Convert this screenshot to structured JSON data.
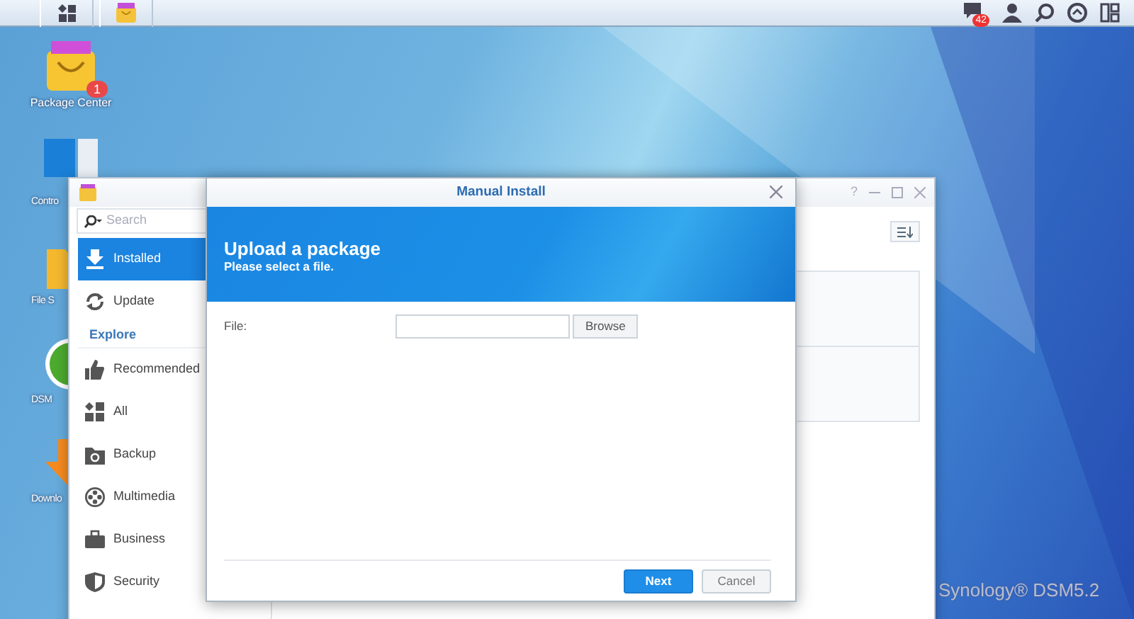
{
  "taskbar": {
    "notification_count": "42"
  },
  "desktop": {
    "icons": [
      {
        "label": "Package Center",
        "badge": "1"
      },
      {
        "label": "Contro"
      },
      {
        "label": "File S"
      },
      {
        "label": "DSM"
      },
      {
        "label": "Downlo"
      }
    ],
    "brand": "Synology® DSM5.2"
  },
  "package_center": {
    "help_label": "?",
    "search": {
      "placeholder": "Search"
    },
    "sidebar": [
      {
        "kind": "item",
        "label": "Installed",
        "selected": true
      },
      {
        "kind": "item",
        "label": "Update",
        "selected": false
      },
      {
        "kind": "section",
        "label": "Explore"
      },
      {
        "kind": "item",
        "label": "Recommended",
        "selected": false
      },
      {
        "kind": "item",
        "label": "All",
        "selected": false
      },
      {
        "kind": "item",
        "label": "Backup",
        "selected": false
      },
      {
        "kind": "item",
        "label": "Multimedia",
        "selected": false
      },
      {
        "kind": "item",
        "label": "Business",
        "selected": false
      },
      {
        "kind": "item",
        "label": "Security",
        "selected": false
      }
    ]
  },
  "dialog": {
    "title": "Manual Install",
    "banner": {
      "title": "Upload a package",
      "subtitle": "Please select a file."
    },
    "fields": [
      {
        "label": "File:",
        "button": "Browse"
      }
    ],
    "buttons": [
      {
        "label": "Next",
        "kind": "primary"
      },
      {
        "label": "Cancel",
        "kind": "secondary"
      }
    ]
  }
}
